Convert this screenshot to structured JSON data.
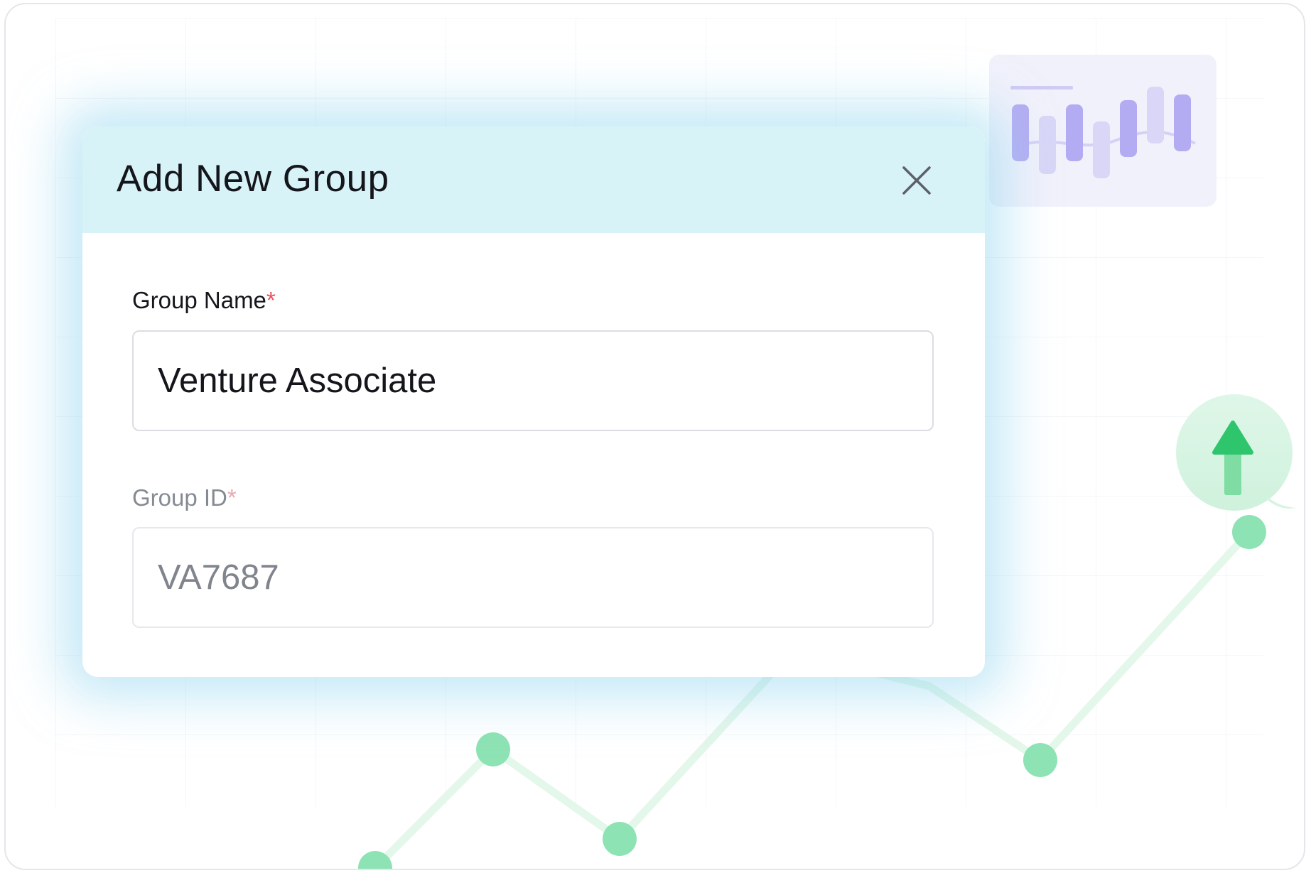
{
  "modal": {
    "title": "Add New Group",
    "close_icon": "close-icon",
    "fields": [
      {
        "label": "Group Name",
        "required_mark": "*",
        "value": "Venture Associate",
        "enabled": true
      },
      {
        "label": "Group ID",
        "required_mark": "*",
        "value": "VA7687",
        "enabled": false
      }
    ]
  },
  "background": {
    "line_chart_icon": "trend-line-chart",
    "bar_chart_card_icon": "mini-bar-chart",
    "trend_badge_icon": "up-arrow-icon"
  },
  "colors": {
    "header_bg": "#d7f3f7",
    "required": "#ef4a5f",
    "chart_point": "#8de3b3",
    "chart_line": "#e3f7ea",
    "arrow": "#2ec56d",
    "bar_primary": "#b4acf2",
    "bar_secondary": "#d9d6f7"
  }
}
